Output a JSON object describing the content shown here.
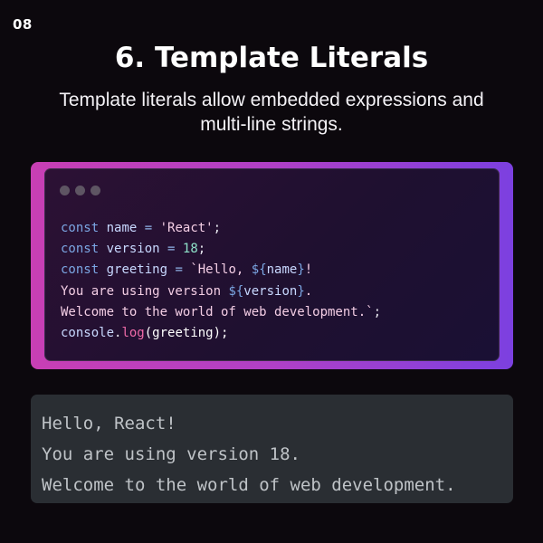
{
  "page_number": "08",
  "title": "6. Template Literals",
  "subtitle_lines": [
    "Template literals allow embedded expressions and",
    "multi-line strings."
  ],
  "colors": {
    "background": "#0c080d",
    "frame_gradient": [
      "#c83fb4",
      "#7c40e0"
    ],
    "keyword": "#7ba6e3",
    "string": "#f3cde4",
    "number": "#8ee0c8",
    "function": "#f06aa8",
    "output_bg": "#2a2e33"
  },
  "window_controls": [
    "dot",
    "dot",
    "dot"
  ],
  "code_lines": [
    [
      {
        "t": "const",
        "c": "kw"
      },
      {
        "t": " ",
        "c": "plain"
      },
      {
        "t": "name",
        "c": "var"
      },
      {
        "t": " = ",
        "c": "op"
      },
      {
        "t": "'React'",
        "c": "str"
      },
      {
        "t": ";",
        "c": "punc"
      }
    ],
    [
      {
        "t": "const",
        "c": "kw"
      },
      {
        "t": " ",
        "c": "plain"
      },
      {
        "t": "version",
        "c": "var"
      },
      {
        "t": " = ",
        "c": "op"
      },
      {
        "t": "18",
        "c": "num"
      },
      {
        "t": ";",
        "c": "punc"
      }
    ],
    [
      {
        "t": "const",
        "c": "kw"
      },
      {
        "t": " ",
        "c": "plain"
      },
      {
        "t": "greeting",
        "c": "var"
      },
      {
        "t": " = ",
        "c": "op"
      },
      {
        "t": "`Hello, ",
        "c": "str"
      },
      {
        "t": "${",
        "c": "kw"
      },
      {
        "t": "name",
        "c": "interp"
      },
      {
        "t": "}",
        "c": "kw"
      },
      {
        "t": "!",
        "c": "str"
      }
    ],
    [
      {
        "t": "You are using version ",
        "c": "str"
      },
      {
        "t": "${",
        "c": "kw"
      },
      {
        "t": "version",
        "c": "interp"
      },
      {
        "t": "}",
        "c": "kw"
      },
      {
        "t": ".",
        "c": "str"
      }
    ],
    [
      {
        "t": "Welcome to the world of web development.`",
        "c": "str"
      },
      {
        "t": ";",
        "c": "punc"
      }
    ],
    [
      {
        "t": "console",
        "c": "var"
      },
      {
        "t": ".",
        "c": "punc"
      },
      {
        "t": "log",
        "c": "fn"
      },
      {
        "t": "(greeting);",
        "c": "plain"
      }
    ]
  ],
  "output_lines": [
    "Hello, React!",
    "You are using version 18.",
    "Welcome to the world of web development."
  ]
}
